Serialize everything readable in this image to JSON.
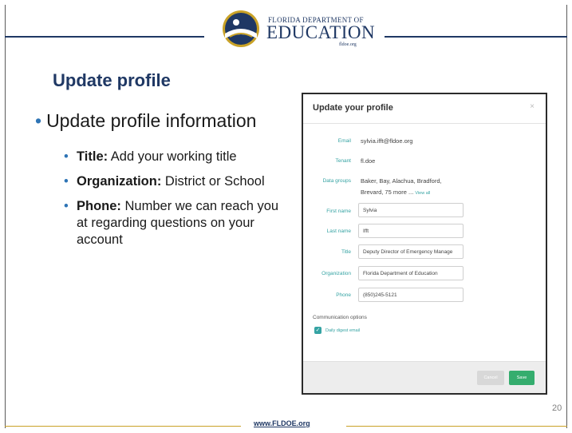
{
  "logo": {
    "small_text": "Florida Department of",
    "big_text": "EDUCATION",
    "url_text": "fldoe.org"
  },
  "slide": {
    "title": "Update profile",
    "main_bullet": "Update profile information",
    "sub_bullets": [
      {
        "label": "Title:",
        "text": " Add your working title"
      },
      {
        "label": "Organization:",
        "text": " District or School"
      },
      {
        "label": "Phone:",
        "text": " Number we can reach you at regarding questions on your account"
      }
    ]
  },
  "dialog": {
    "title": "Update your profile",
    "close_glyph": "×",
    "email_label": "Email",
    "email_value": "sylvia.ifft@fldoe.org",
    "tenant_label": "Tenant",
    "tenant_value": "fl.doe",
    "datagroups_label": "Data groups",
    "datagroups_line1": "Baker, Bay, Alachua, Bradford,",
    "datagroups_line2": "Brevard, 75 more ...",
    "view_all": "View all",
    "first_name_label": "First name",
    "first_name_value": "Sylvia",
    "last_name_label": "Last name",
    "last_name_value": "Ifft",
    "title_label": "Title",
    "title_value": "Deputy Director of Emergency Manage",
    "organization_label": "Organization",
    "organization_value": "Florida Department of Education",
    "phone_label": "Phone",
    "phone_value": "(850)245-5121",
    "comm_label": "Communication options",
    "daily_digest_label": "Daily digest email",
    "cancel_label": "Cancel",
    "save_label": "Save"
  },
  "footer": {
    "link": "www.FLDOE.org",
    "page_number": "20"
  },
  "colors": {
    "brand_navy": "#1f3864",
    "bullet_blue": "#2e74b5",
    "teal": "#35a3a3",
    "save_green": "#35ad6e",
    "gold": "#c9a227"
  }
}
